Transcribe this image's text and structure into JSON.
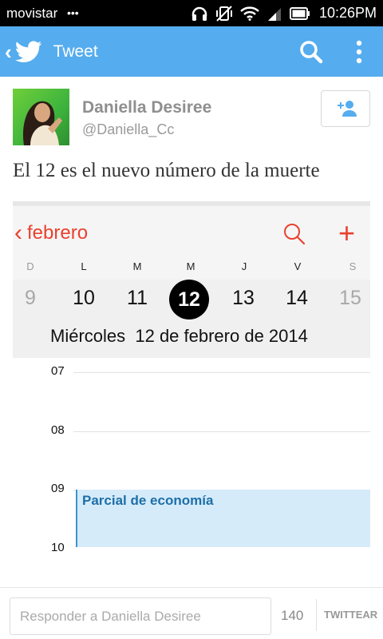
{
  "status_bar": {
    "carrier": "movistar",
    "time": "10:26PM"
  },
  "app_bar": {
    "title": "Tweet",
    "color": "#55acee"
  },
  "tweet": {
    "user_name": "Daniella Desiree",
    "user_handle": "@Daniella_Cc",
    "text": "El 12 es el nuevo número de la muerte"
  },
  "calendar_image": {
    "month": "febrero",
    "weekdays": [
      "D",
      "L",
      "M",
      "M",
      "J",
      "V",
      "S"
    ],
    "days": [
      "9",
      "10",
      "11",
      "12",
      "13",
      "14",
      "15"
    ],
    "selected_day": "12",
    "date_line": "Miércoles  12 de febrero de 2014",
    "hours": [
      "07",
      "08",
      "09",
      "10"
    ],
    "event": "Parcial de  economía",
    "accent_color": "#e9412f"
  },
  "reply": {
    "placeholder": "Responder a Daniella Desiree",
    "char_count": "140",
    "tweet_button": "TWITTEAR"
  }
}
